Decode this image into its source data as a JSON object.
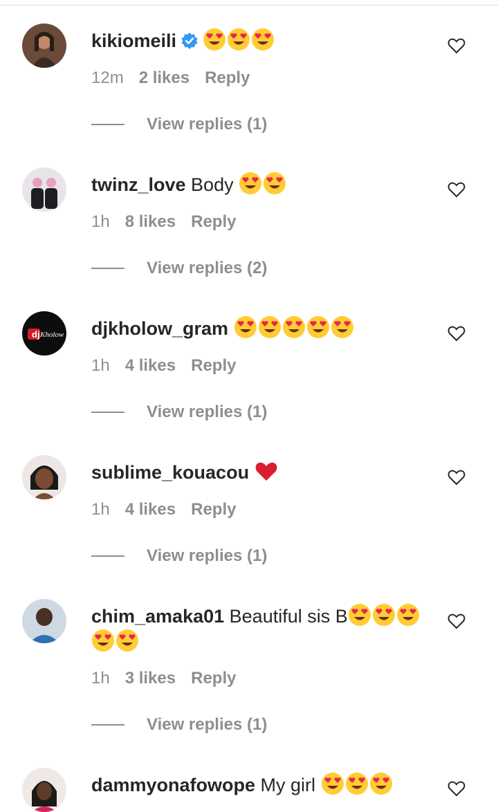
{
  "colors": {
    "accent": "#3897f0",
    "muted": "#8e8e8e",
    "text": "#262626",
    "heart": "#e0245e"
  },
  "comments": [
    {
      "username": "kikiomeili",
      "verified": true,
      "text": "",
      "emoji": [
        "😍",
        "😍",
        "😍"
      ],
      "time": "12m",
      "likes": "2 likes",
      "reply": "Reply",
      "view_replies": "View replies (1)"
    },
    {
      "username": "twinz_love",
      "verified": false,
      "text": "Body",
      "emoji": [
        "😍",
        "😍"
      ],
      "time": "1h",
      "likes": "8 likes",
      "reply": "Reply",
      "view_replies": "View replies (2)"
    },
    {
      "username": "djkholow_gram",
      "verified": false,
      "text": "",
      "emoji": [
        "😍",
        "😍",
        "😍",
        "😍",
        "😍"
      ],
      "time": "1h",
      "likes": "4 likes",
      "reply": "Reply",
      "view_replies": "View replies (1)"
    },
    {
      "username": "sublime_kouacou",
      "verified": false,
      "text": "",
      "emoji": [
        "❤️"
      ],
      "time": "1h",
      "likes": "4 likes",
      "reply": "Reply",
      "view_replies": "View replies (1)"
    },
    {
      "username": "chim_amaka01",
      "verified": false,
      "text": "Beautiful sis B",
      "emoji": [
        "😍",
        "😍",
        "😍",
        "😍",
        "😍"
      ],
      "time": "1h",
      "likes": "3 likes",
      "reply": "Reply",
      "view_replies": "View replies (1)"
    },
    {
      "username": "dammyonafowope",
      "verified": false,
      "text": "My girl",
      "emoji": [
        "😍",
        "😍",
        "😍"
      ],
      "time": "",
      "likes": "",
      "reply": "",
      "view_replies": ""
    }
  ],
  "avatar_logo_text": "Kholow"
}
